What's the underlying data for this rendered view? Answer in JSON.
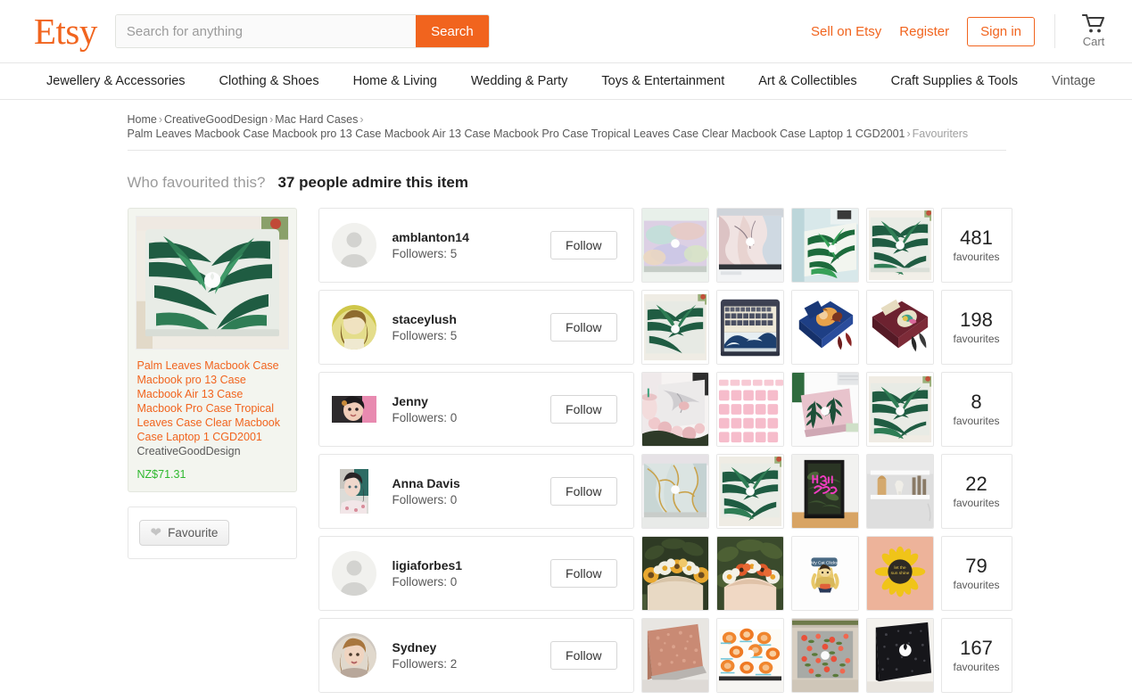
{
  "header": {
    "logo": "Etsy",
    "search": {
      "placeholder": "Search for anything",
      "value": "",
      "button": "Search"
    },
    "links": [
      {
        "label": "Sell on Etsy",
        "name": "sell-on-etsy-link"
      },
      {
        "label": "Register",
        "name": "register-link"
      }
    ],
    "signin": "Sign in",
    "cart_label": "Cart"
  },
  "nav": {
    "items": [
      "Jewellery & Accessories",
      "Clothing & Shoes",
      "Home & Living",
      "Wedding & Party",
      "Toys & Entertainment",
      "Art & Collectibles",
      "Craft Supplies & Tools",
      "Vintage"
    ]
  },
  "breadcrumb": {
    "home": "Home",
    "shop": "CreativeGoodDesign",
    "category": "Mac Hard Cases",
    "product": "Palm Leaves Macbook Case Macbook pro 13 Case Macbook Air 13 Case Macbook Pro Case Tropical Leaves Case Clear Macbook Case Laptop 1 CGD2001",
    "current": "Favouriters",
    "separator": "›"
  },
  "heading": {
    "question": "Who favourited this?",
    "answer": "37 people admire this item"
  },
  "listing": {
    "title": "Palm Leaves Macbook Case Macbook pro 13 Case Macbook Air 13 Case Macbook Pro Case Tropical Leaves Case Clear Macbook Case Laptop 1 CGD2001",
    "shop": "CreativeGoodDesign",
    "price": "NZ$71.31",
    "favourite_button": "Favourite"
  },
  "labels": {
    "followers_prefix": "Followers:",
    "follow": "Follow",
    "favourites": "favourites"
  },
  "colors": {
    "brand_orange": "#f1641e",
    "price_green": "#2eb82e",
    "text": "#222222",
    "muted": "#595959"
  },
  "people": [
    {
      "name": "amblanton14",
      "followers": "5",
      "follow": "Follow",
      "favourites_count": "481",
      "avatar": "placeholder",
      "avatar_shape": "circle",
      "thumbs": [
        "holographic-macbook-case",
        "pink-marble-macbook-case",
        "palm-leaf-macbook-case-angled",
        "palm-leaf-macbook-case"
      ]
    },
    {
      "name": "staceylush",
      "followers": "5",
      "follow": "Follow",
      "favourites_count": "198",
      "avatar": "photo-blonde-woman",
      "avatar_shape": "circle",
      "thumbs": [
        "palm-leaf-macbook-case",
        "great-wave-keyboard-cover",
        "beauty-and-the-beast-book-clutch",
        "recently-deceased-book-clutch"
      ]
    },
    {
      "name": "Jenny",
      "followers": "0",
      "follow": "Follow",
      "favourites_count": "8",
      "avatar": "photo-dark-hair-woman",
      "avatar_shape": "wide",
      "thumbs": [
        "marble-case-with-flowers",
        "pink-keyboard-cover",
        "pink-fern-macbook-case",
        "palm-leaf-macbook-case"
      ]
    },
    {
      "name": "Anna Davis",
      "followers": "0",
      "follow": "Follow",
      "favourites_count": "22",
      "avatar": "photo-woman-teal",
      "avatar_shape": "tall",
      "thumbs": [
        "blue-gold-marble-macbook-case",
        "palm-leaf-macbook-case",
        "neon-pink-framed-art-print",
        "white-wall-shelf"
      ]
    },
    {
      "name": "ligiaforbes1",
      "followers": "0",
      "follow": "Follow",
      "favourites_count": "79",
      "avatar": "placeholder",
      "avatar_shape": "circle",
      "thumbs": [
        "sunflower-flower-crown",
        "daisy-poppy-flower-crown",
        "enamel-pin-character",
        "sunflower-enamel-pin"
      ]
    },
    {
      "name": "Sydney",
      "followers": "2",
      "follow": "Follow",
      "favourites_count": "167",
      "avatar": "photo-woman-portrait",
      "avatar_shape": "circle",
      "thumbs": [
        "rose-gold-glitter-macbook-case",
        "peach-pattern-macbook-case",
        "grey-floral-macbook-case",
        "black-glitter-macbook-case"
      ]
    }
  ]
}
